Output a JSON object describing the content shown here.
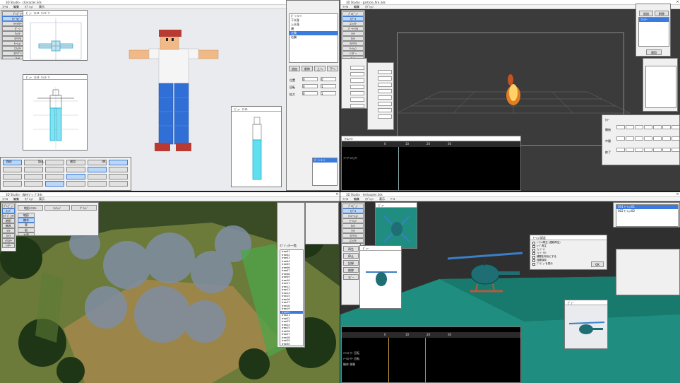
{
  "q1": {
    "title": "3D Studio - character.3ds",
    "menu": [
      "ﾌｧｲﾙ",
      "編集",
      "ｵﾌﾟｼｮﾝ",
      "表示"
    ],
    "toolbox": [
      "ﾌﾟﾚﾋﾞｭｰ",
      "ﾓﾃﾞﾙﾋﾞｭｰ",
      "ｷｬﾗｸﾀｰ",
      "ﾎﾞｰﾝ",
      "ｳｪｲﾄ",
      "ﾏﾃﾘｱﾙ",
      "ﾓｰｼｮﾝ",
      "ｴﾌｪｸﾄ",
      "ｽｸﾘﾌﾟﾄ",
      "ﾂｰﾙ"
    ],
    "view_menu": [
      "ﾋﾞｭｰ",
      "ﾌｧｲﾙ",
      "ｳｨﾝﾄﾞｳ"
    ],
    "parts_items": [
      "ﾎﾞｰﾝ ﾙｰﾄ",
      "下半身",
      "上半身",
      "頭",
      "左腕",
      "右腕"
    ],
    "parts_buttons": [
      "追加",
      "削除",
      "上へ",
      "下へ"
    ],
    "param_labels": [
      "位置",
      "回転",
      "拡大"
    ],
    "param_values": [
      "0",
      "0",
      "0",
      "1",
      "0",
      "1"
    ],
    "ops": [
      "保存",
      "読込",
      "適用",
      "OK"
    ]
  },
  "q2": {
    "title": "3D Studio - particle_fire.3ds",
    "menu": [
      "ﾌｧｲﾙ",
      "編集",
      "ｵﾌﾟｼｮﾝ"
    ],
    "toolbox": [
      "ﾌﾟﾚﾋﾞｭｰ",
      "ﾓﾃﾞﾙ",
      "ｴﾌｪｸﾄ",
      "ﾊﾟｰﾃｨｸﾙ",
      "ﾗｲﾄ",
      "ｶﾒﾗ",
      "ﾏﾃﾘｱﾙ",
      "ﾓｰｼｮﾝ",
      "ﾚﾝﾀﾞｰ",
      "ﾂｰﾙ"
    ],
    "emitter_items": [
      "ﾌｧｲｱｰ"
    ],
    "emitter_buttons": [
      "追加",
      "削除"
    ],
    "ok": "適用",
    "timeline_label": "ﾀｲﾑﾗｲﾝ",
    "track_label": "ﾌｧｲｱｰｴﾌｪｸﾄ",
    "frame_marks": [
      "0",
      "10",
      "20",
      "30"
    ],
    "color_header": "ｶﾗｰ",
    "color_rows": [
      "開始",
      "中間",
      "終了"
    ]
  },
  "q3": {
    "title": "3D Studio - 森林マップ.3ds",
    "menu": [
      "ﾌｧｲﾙ",
      "編集",
      "ｵﾌﾟｼｮﾝ",
      "表示"
    ],
    "toolbox": [
      "ﾌﾟﾚﾋﾞｭｰ",
      "ﾏｯﾌﾟ",
      "ｵﾌﾞｼﾞｪｸﾄ",
      "地形",
      "樹木",
      "ﾗｲﾄ",
      "ｶﾒﾗ",
      "ﾃｸｽﾁｬ",
      "ﾚｲﾔｰ"
    ],
    "panel_buttons": [
      "地形ﾃｸｽﾁｬ",
      "ﾌｫﾘｯｼﾞ",
      "ｸﾞﾘｯﾄﾞ"
    ],
    "panel_items": [
      "地形",
      "樹木",
      "草",
      "岩",
      "水面"
    ],
    "tree_list_header": "ｵﾌﾞｼﾞｪｸﾄ一覧",
    "tree_items": [
      "tree01",
      "tree02",
      "tree03",
      "tree04",
      "tree05",
      "tree06",
      "tree07",
      "tree08",
      "tree09",
      "tree10",
      "tree11",
      "tree12",
      "tree13",
      "tree14",
      "tree15",
      "tree16",
      "tree17",
      "tree18",
      "tree19",
      "tree20",
      "tree21",
      "tree22",
      "tree23",
      "tree24",
      "tree25",
      "tree26",
      "tree27",
      "tree28",
      "tree29",
      "tree30"
    ]
  },
  "q4": {
    "title": "3D Studio - helicopter.3ds",
    "menu": [
      "ﾌｧｲﾙ",
      "編集",
      "ｵﾌﾟｼｮﾝ",
      "表示",
      "ﾂｰﾙ"
    ],
    "toolbox": [
      "ﾌﾟﾚﾋﾞｭｰ",
      "ﾓﾃﾞﾙ",
      "ｱﾆﾒｰｼｮﾝ",
      "ﾓｰｼｮﾝ",
      "ｶﾒﾗ",
      "ﾗｲﾄ",
      "ﾏﾃﾘｱﾙ",
      "ｴﾌｪｸﾄ",
      "ｽｸﾘﾌﾟﾄ",
      "ﾂｰﾙ"
    ],
    "motion_items": [
      "001 ﾓｰｼｮﾝ01",
      "002 ﾓｰｼｮﾝ02"
    ],
    "dialog_title": "ﾓｰｼｮﾝ設定",
    "dialog_options": [
      "ｼｰｹﾝｽ再生 (連続再生)",
      "ﾙｰﾌﾟ再生",
      "ﾌｪｰﾄﾞｲﾝ",
      "ﾌｪｰﾄﾞｱｳﾄ",
      "補間を有効にする",
      "自動保存",
      "ﾌﾟﾚﾋﾞｭｰを表示"
    ],
    "dialog_ok": "OK",
    "timeline_tracks": [
      "ﾒｲﾝﾛｰﾀｰ 回転",
      "ﾃｰﾙﾛｰﾀｰ 回転",
      "機体 移動"
    ],
    "frame_marks": [
      "0",
      "10",
      "20",
      "30"
    ],
    "side_labels": [
      "再生",
      "停止",
      "記録",
      "削除",
      "ｺﾋﾟｰ"
    ]
  },
  "colors": {
    "sky": "#e9ebef",
    "char_shirt": "#f5f5f5",
    "char_jeans": "#2f6fd6",
    "char_skin": "#f1b985",
    "char_hair": "#b93a32",
    "fire": "#ff8a1c",
    "helicopter": "#1f6e74",
    "water": "#1f8e80"
  }
}
